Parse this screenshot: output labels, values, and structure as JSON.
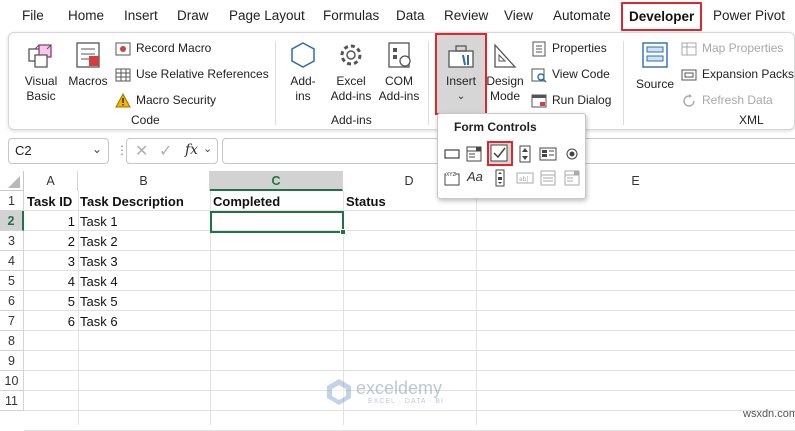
{
  "menu": {
    "tabs": [
      "File",
      "Home",
      "Insert",
      "Draw",
      "Page Layout",
      "Formulas",
      "Data",
      "Review",
      "View",
      "Automate",
      "Developer",
      "Power Pivot"
    ]
  },
  "ribbon": {
    "code": {
      "visual_basic": [
        "Visual",
        "Basic"
      ],
      "macros": "Macros",
      "record_macro": "Record Macro",
      "relative_refs": "Use Relative References",
      "macro_security": "Macro Security",
      "group_label": "Code"
    },
    "addins": {
      "addins": [
        "Add-",
        "ins"
      ],
      "excel_addins": [
        "Excel",
        "Add-ins"
      ],
      "com_addins": [
        "COM",
        "Add-ins"
      ],
      "group_label": "Add-ins"
    },
    "controls": {
      "insert": "Insert",
      "design_mode": [
        "Design",
        "Mode"
      ],
      "properties": "Properties",
      "view_code": "View Code",
      "run_dialog": "Run Dialog"
    },
    "xml": {
      "source": "Source",
      "map_properties": "Map Properties",
      "expansion_packs": "Expansion Packs",
      "refresh_data": "Refresh Data",
      "group_label": "XML"
    }
  },
  "formula_bar": {
    "name_box": "C2",
    "fx": "fx",
    "formula": ""
  },
  "dropdown": {
    "title": "Form Controls",
    "row1": [
      "button",
      "combo-box",
      "check-box",
      "spin-button",
      "list-box",
      "option-button"
    ],
    "row2": [
      "group-box",
      "label",
      "scroll-bar",
      "text-field",
      "combo-list-edit",
      "combo-drop-down-edit"
    ]
  },
  "sheet": {
    "columns": [
      "A",
      "B",
      "C",
      "D",
      "E"
    ],
    "rows": [
      "1",
      "2",
      "3",
      "4",
      "5",
      "6",
      "7",
      "8",
      "9",
      "10",
      "11"
    ],
    "headers": [
      "Task ID",
      "Task Description",
      "Completed",
      "Status"
    ],
    "data": [
      {
        "id": "1",
        "desc": "Task 1"
      },
      {
        "id": "2",
        "desc": "Task 2"
      },
      {
        "id": "3",
        "desc": "Task 3"
      },
      {
        "id": "4",
        "desc": "Task 4"
      },
      {
        "id": "5",
        "desc": "Task 5"
      },
      {
        "id": "6",
        "desc": "Task 6"
      }
    ],
    "active_cell": "C2"
  },
  "watermark": {
    "brand": "exceldemy",
    "tagline": "EXCEL · DATA · BI"
  },
  "site_watermark": "wsxdn.com",
  "colors": {
    "highlight": "#e0262b",
    "excel_green": "#217346",
    "selected_btn": "#d6d6d6"
  }
}
